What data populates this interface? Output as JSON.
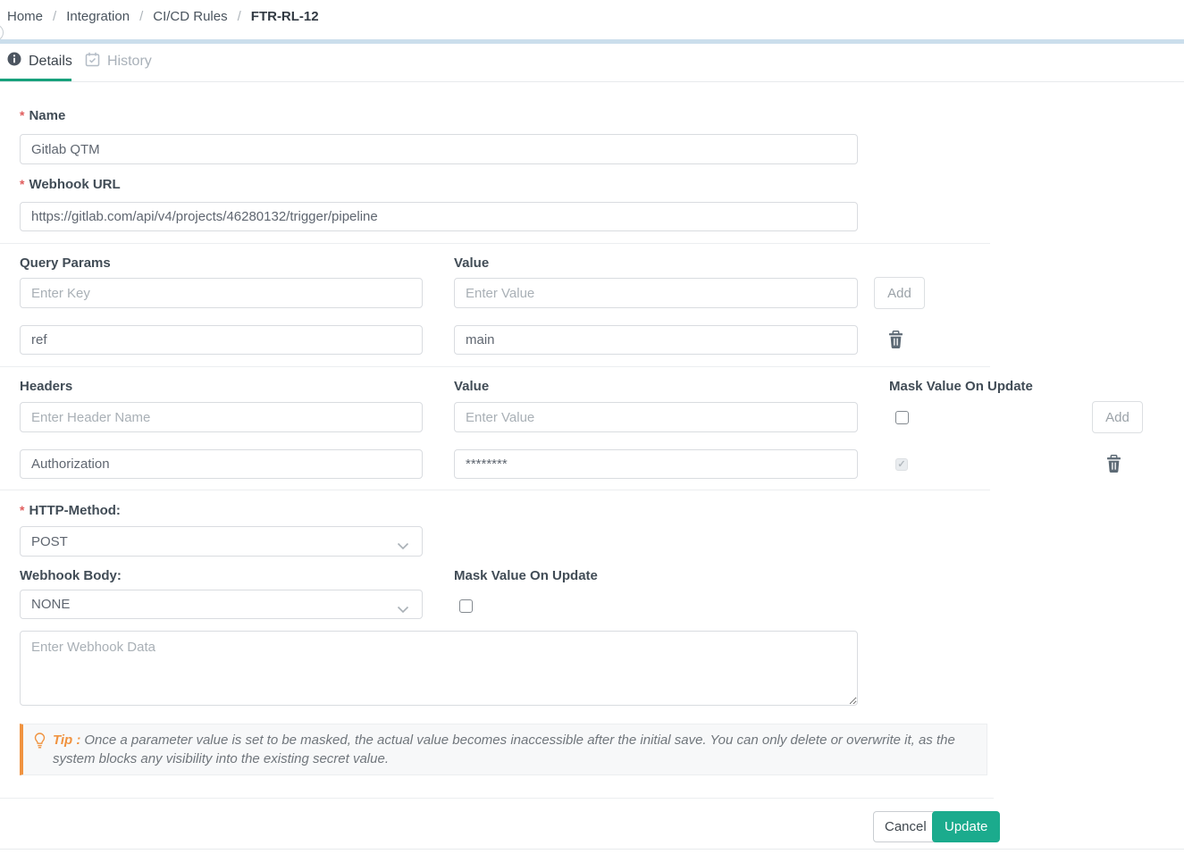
{
  "breadcrumb": {
    "separator": "/",
    "items": [
      "Home",
      "Integration",
      "CI/CD Rules"
    ],
    "current": "FTR-RL-12"
  },
  "tabs": {
    "details": "Details",
    "history": "History"
  },
  "form": {
    "required_marker": "*",
    "name": {
      "label": "Name",
      "value": "Gitlab QTM"
    },
    "webhook_url": {
      "label": "Webhook URL",
      "value": "https://gitlab.com/api/v4/projects/46280132/trigger/pipeline"
    },
    "query_params": {
      "key_label": "Query Params",
      "value_label": "Value",
      "key_placeholder": "Enter Key",
      "value_placeholder": "Enter Value",
      "add_label": "Add",
      "rows": [
        {
          "key": "ref",
          "value": "main"
        }
      ]
    },
    "headers": {
      "name_label": "Headers",
      "value_label": "Value",
      "mask_label": "Mask Value On Update",
      "name_placeholder": "Enter Header Name",
      "value_placeholder": "Enter Value",
      "add_label": "Add",
      "mask_checked": false,
      "rows": [
        {
          "name": "Authorization",
          "value": "********",
          "masked": true
        }
      ]
    },
    "http_method": {
      "label": "HTTP-Method:",
      "value": "POST"
    },
    "webhook_body": {
      "label": "Webhook Body:",
      "value": "NONE",
      "mask_label": "Mask Value On Update",
      "mask_checked": false
    },
    "webhook_data": {
      "placeholder": "Enter Webhook Data"
    },
    "tip": {
      "label": "Tip :",
      "text": "Once a parameter value is set to be masked, the actual value becomes inaccessible after the initial save. You can only delete or overwrite it, as the system blocks any visibility into the existing secret value."
    },
    "actions": {
      "cancel": "Cancel",
      "update": "Update"
    }
  },
  "colors": {
    "accent_green": "#1bab8d",
    "tab_underline_green": "#17a17c",
    "tip_orange": "#f09340",
    "top_bar_blue": "#cbdeec",
    "required_red": "#e05c5c"
  }
}
